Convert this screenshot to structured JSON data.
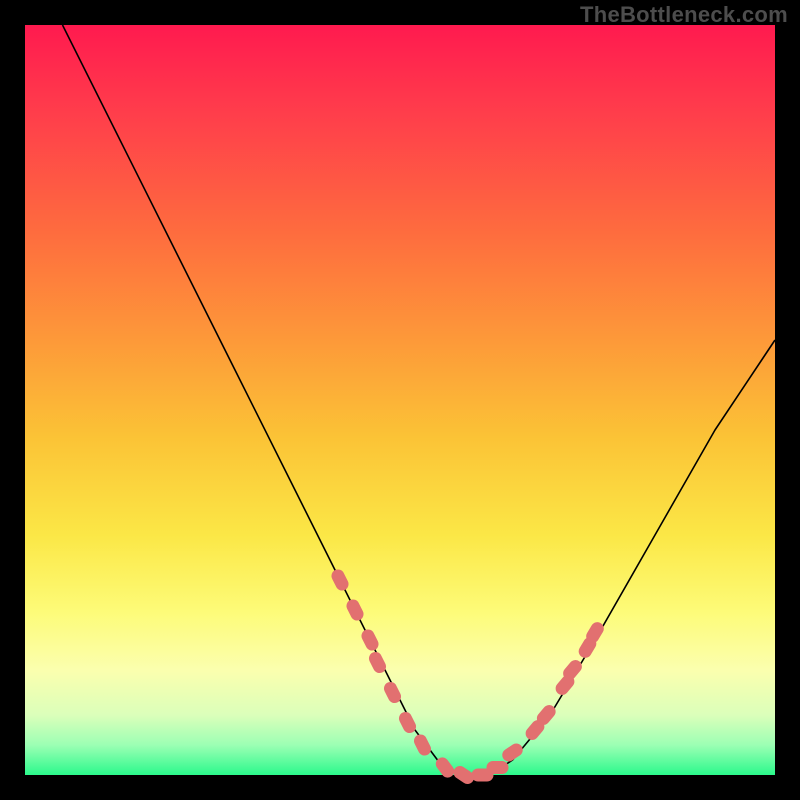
{
  "watermark": "TheBottleneck.com",
  "chart_data": {
    "type": "line",
    "title": "",
    "xlabel": "",
    "ylabel": "",
    "xlim": [
      0,
      100
    ],
    "ylim": [
      0,
      100
    ],
    "grid": false,
    "series": [
      {
        "name": "bottleneck-curve",
        "x": [
          5,
          12,
          20,
          28,
          36,
          42,
          48,
          52,
          55,
          58,
          62,
          65,
          70,
          76,
          84,
          92,
          100
        ],
        "values": [
          100,
          86,
          70,
          54,
          38,
          26,
          14,
          6,
          2,
          0,
          0,
          2,
          8,
          18,
          32,
          46,
          58
        ]
      }
    ],
    "markers": {
      "name": "sample-points",
      "color": "#e27070",
      "radius": 8,
      "points": [
        {
          "x": 42,
          "y": 26
        },
        {
          "x": 44,
          "y": 22
        },
        {
          "x": 46,
          "y": 18
        },
        {
          "x": 47,
          "y": 15
        },
        {
          "x": 49,
          "y": 11
        },
        {
          "x": 51,
          "y": 7
        },
        {
          "x": 53,
          "y": 4
        },
        {
          "x": 56,
          "y": 1
        },
        {
          "x": 58.5,
          "y": 0
        },
        {
          "x": 61,
          "y": 0
        },
        {
          "x": 63,
          "y": 1
        },
        {
          "x": 65,
          "y": 3
        },
        {
          "x": 68,
          "y": 6
        },
        {
          "x": 69.5,
          "y": 8
        },
        {
          "x": 72,
          "y": 12
        },
        {
          "x": 73,
          "y": 14
        },
        {
          "x": 75,
          "y": 17
        },
        {
          "x": 76,
          "y": 19
        }
      ]
    }
  }
}
